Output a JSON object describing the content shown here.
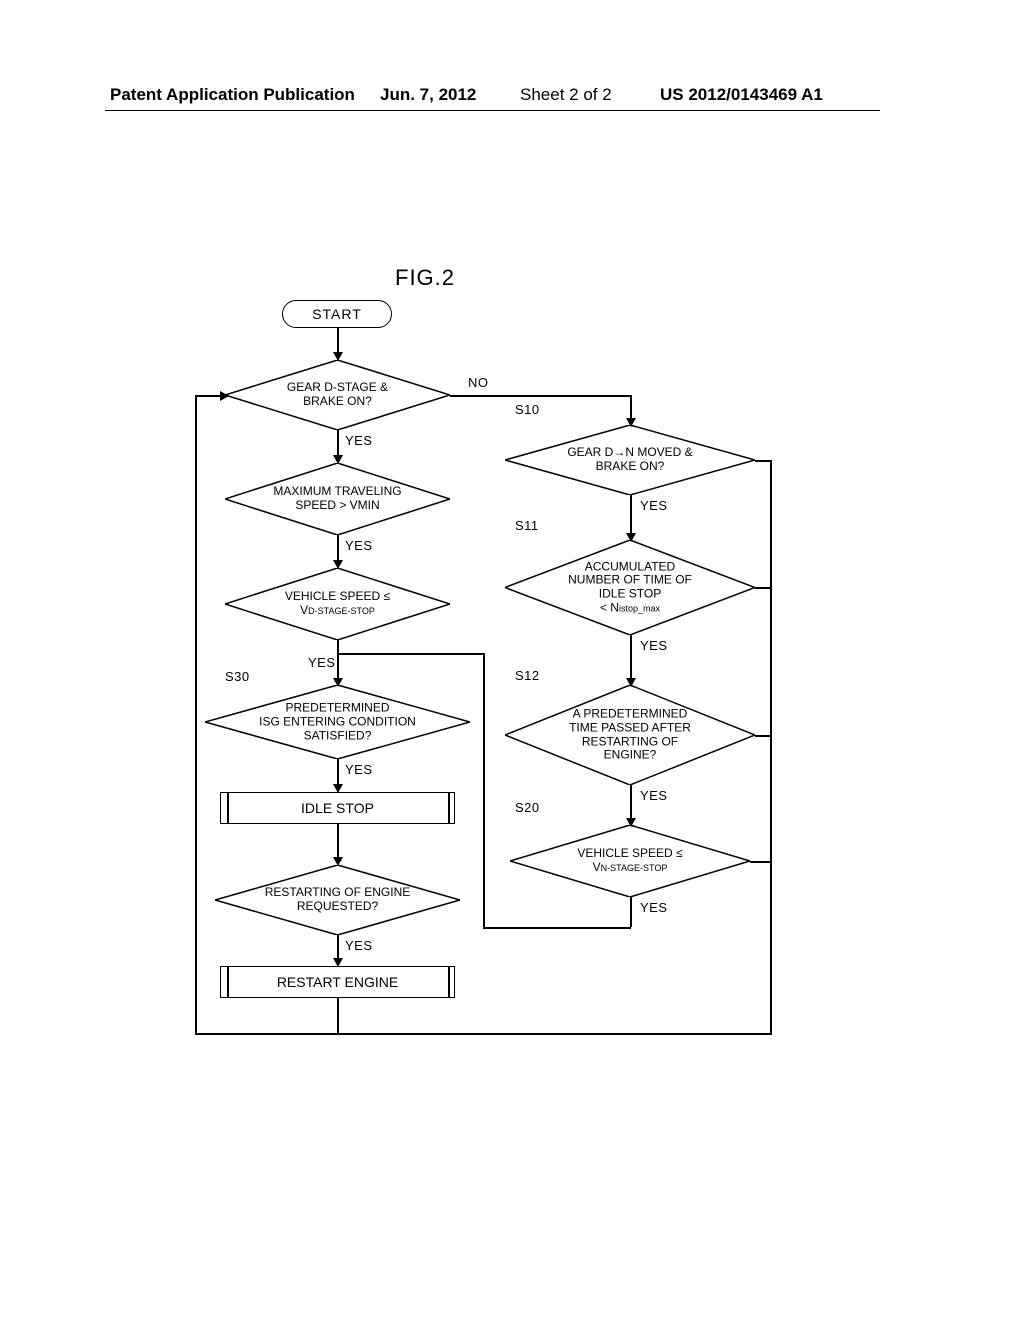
{
  "header": {
    "publication": "Patent Application Publication",
    "date": "Jun. 7, 2012",
    "sheet": "Sheet 2 of 2",
    "us": "US 2012/0143469 A1"
  },
  "figure_label": "FIG.2",
  "nodes": {
    "start": "START",
    "d1": [
      "GEAR D-STAGE &",
      "BRAKE ON?"
    ],
    "d2": [
      "MAXIMUM TRAVELING",
      "SPEED > VMIN"
    ],
    "d3": [
      "VEHICLE SPEED ≤",
      "V",
      "D-STAGE-STOP"
    ],
    "d4_pre": "PREDETERMINED",
    "d4_mid": "ISG ENTERING CONDITION",
    "d4_post": "SATISFIED?",
    "idle_stop": "IDLE STOP",
    "d5": [
      "RESTARTING OF ENGINE",
      "REQUESTED?"
    ],
    "restart": "RESTART ENGINE",
    "d10": [
      "GEAR D→N MOVED &",
      "BRAKE ON?"
    ],
    "d11_a": "ACCUMULATED",
    "d11_b": "NUMBER OF TIME OF",
    "d11_c": "IDLE STOP",
    "d11_d": "< N",
    "d11_sub": "istop_max",
    "d12": [
      "A PREDETERMINED",
      "TIME PASSED AFTER",
      "RESTARTING OF",
      "ENGINE?"
    ],
    "d20": [
      "VEHICLE SPEED ≤",
      "V",
      "N-STAGE-STOP"
    ]
  },
  "labels": {
    "no": "NO",
    "yes": "YES",
    "s10": "S10",
    "s11": "S11",
    "s12": "S12",
    "s20": "S20",
    "s30": "S30"
  }
}
